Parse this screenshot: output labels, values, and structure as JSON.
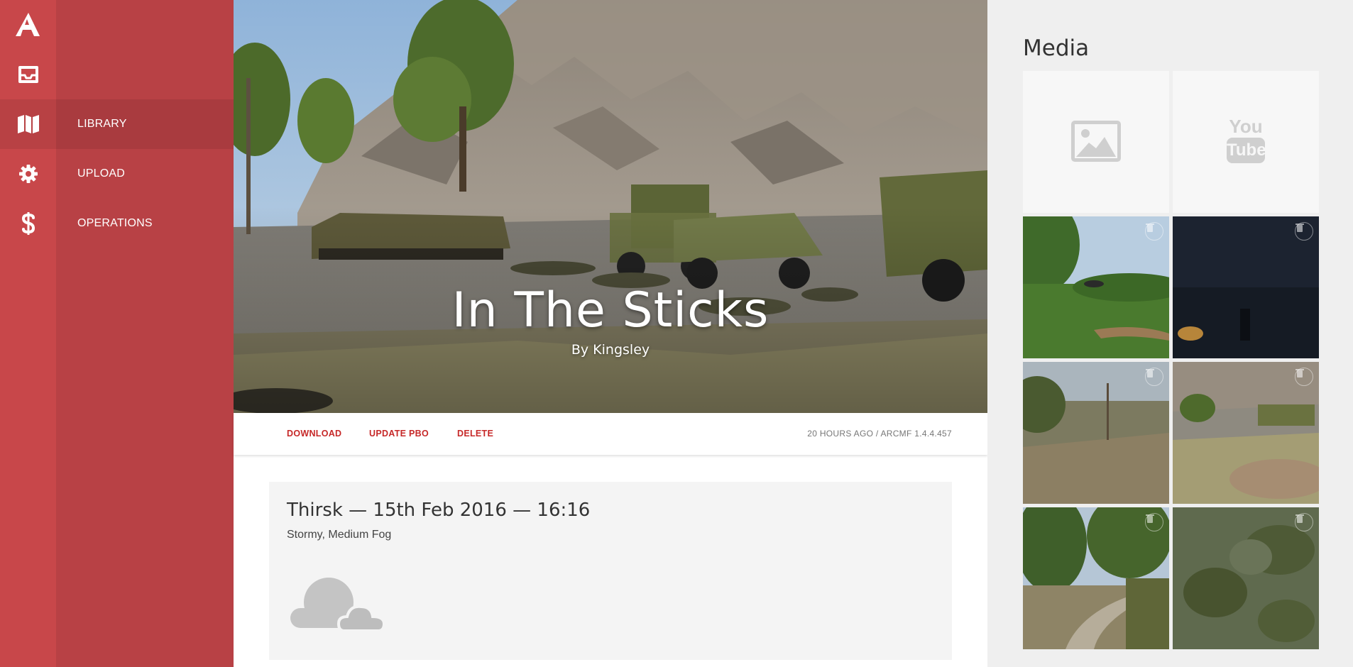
{
  "nav": {
    "brand_icon": "arma-logo-icon",
    "items": [
      {
        "icon": "inbox-icon",
        "label": ""
      },
      {
        "icon": "map-icon",
        "label": "LIBRARY",
        "active": true
      },
      {
        "icon": "gear-icon",
        "label": "UPLOAD"
      },
      {
        "icon": "dollar-icon",
        "label": "OPERATIONS"
      }
    ]
  },
  "hero": {
    "title": "In The Sticks",
    "author": "By Kingsley"
  },
  "actions": {
    "download": "DOWNLOAD",
    "update_pbo": "UPDATE PBO",
    "delete": "DELETE",
    "meta": "20 HOURS AGO / ARCMF 1.4.4.457"
  },
  "weather": {
    "title": "Thirsk — 15th Feb 2016 — 16:16",
    "conditions": "Stormy, Medium Fog",
    "icon": "cloud-icon"
  },
  "media": {
    "title": "Media",
    "add_image_icon": "image-icon",
    "add_video_icon": "youtube-icon",
    "video_icon_text_top": "You",
    "video_icon_text_bottom": "Tube",
    "thumbnails": [
      {
        "icon": "trash-icon"
      },
      {
        "icon": "trash-icon"
      },
      {
        "icon": "trash-icon"
      },
      {
        "icon": "trash-icon"
      },
      {
        "icon": "trash-icon"
      },
      {
        "icon": "trash-icon"
      }
    ]
  },
  "colors": {
    "rail": "#c8474a",
    "sidebar": "#b84145",
    "accent": "#c62828"
  }
}
